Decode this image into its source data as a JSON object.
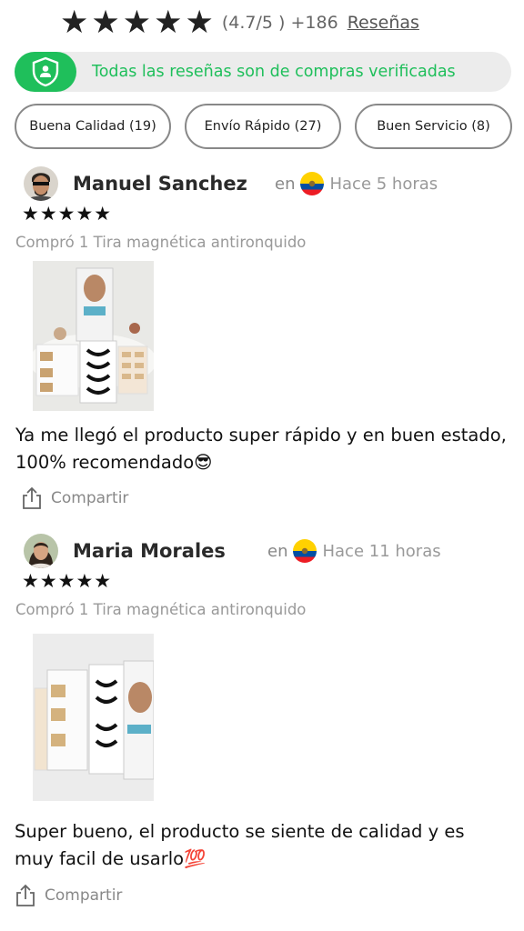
{
  "summary": {
    "stars": "★★★★★",
    "rating": "(4.7/5 ) +186",
    "reviews_link": "Reseñas"
  },
  "verified": {
    "text": "Todas las reseñas son de compras verificadas",
    "color": "#1fbf5b"
  },
  "tags": [
    {
      "label": "Buena Calidad (19)"
    },
    {
      "label": "Envío Rápido (27)"
    },
    {
      "label": "Buen Servicio (8)"
    }
  ],
  "reviews": [
    {
      "name": "Manuel Sanchez",
      "en": "en",
      "time": "Hace 5 horas",
      "stars": "★★★★★",
      "product": "Compró 1 Tira magnética antironquido",
      "text": "Ya me llegó el producto super rápido y en buen estado, 100% recomendado😎",
      "share": "Compartir"
    },
    {
      "name": "Maria Morales",
      "en": "en",
      "time": "Hace 11 horas",
      "stars": "★★★★★",
      "product": "Compró 1 Tira magnética antironquido",
      "text": "Super bueno, el producto se siente de calidad y es muy facil de usarlo💯",
      "share": "Compartir"
    }
  ]
}
